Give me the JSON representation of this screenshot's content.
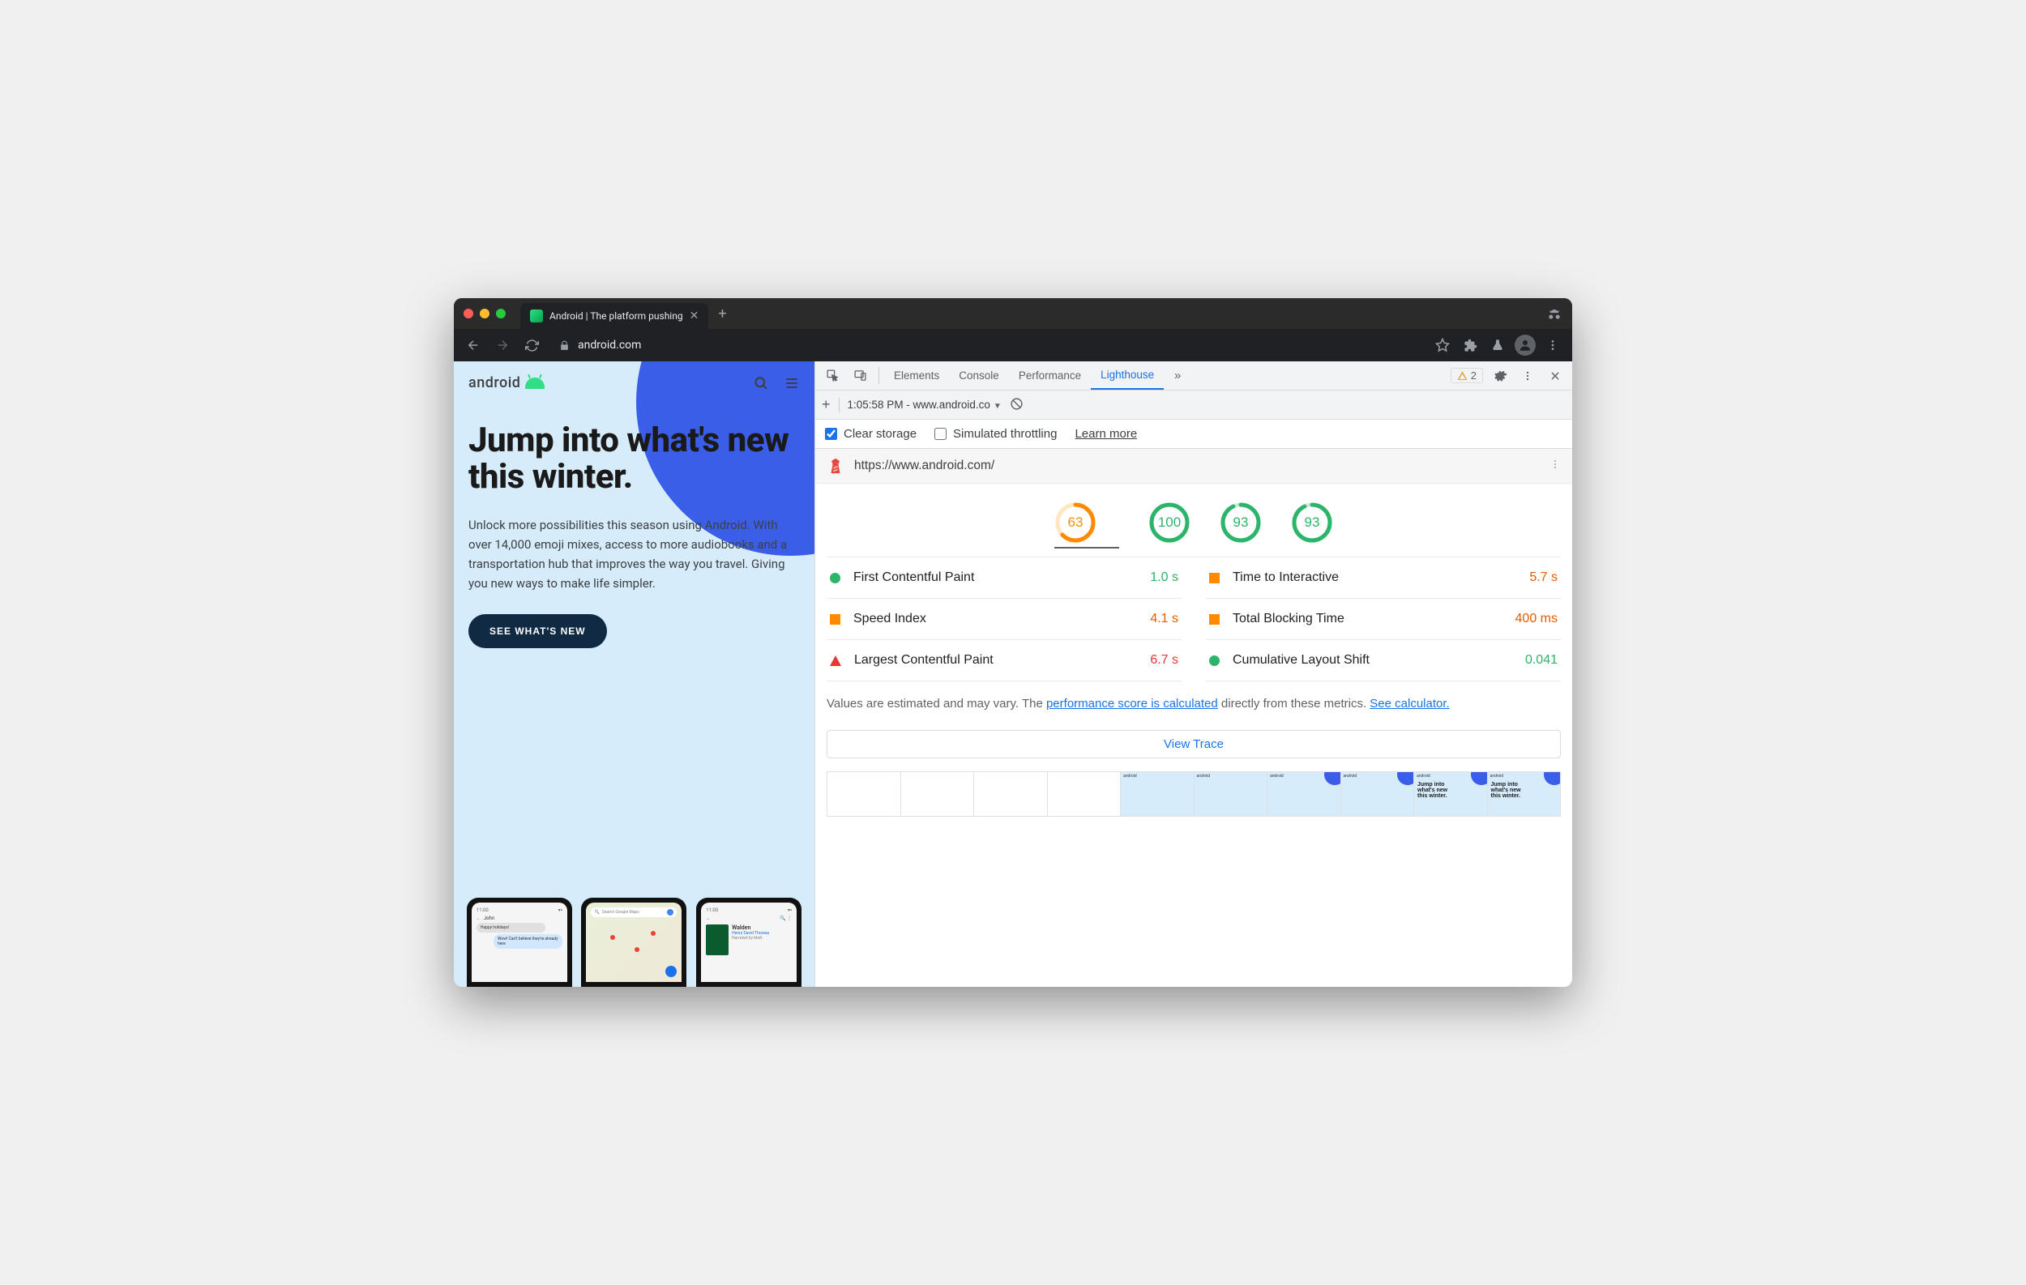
{
  "browser": {
    "tab_title": "Android | The platform pushing",
    "url": "android.com",
    "warnings_count": "2"
  },
  "page": {
    "logo": "android",
    "hero_title": "Jump into what's new this winter.",
    "hero_body": "Unlock more possibilities this season using Android. With over 14,000 emoji mixes, access to more audiobooks and a transportation hub that improves the way you travel. Giving you new ways to make life simpler.",
    "cta": "SEE WHAT'S NEW",
    "phone_mock": {
      "chat_name": "John",
      "chat_msgs": [
        "Happy holidays!",
        "Wow! Can't believe they're already here"
      ],
      "maps_search": "Search Google Maps",
      "book_title": "Walden",
      "book_author": "Henry David Thoreau",
      "book_sub": "Narrated by Matt"
    }
  },
  "devtools": {
    "tabs": {
      "elements": "Elements",
      "console": "Console",
      "performance": "Performance",
      "lighthouse": "Lighthouse"
    },
    "toolbar": {
      "timestamp": "1:05:58 PM - www.android.co"
    },
    "options": {
      "clear_storage": "Clear storage",
      "simulated_throttling": "Simulated throttling",
      "learn_more": "Learn more"
    },
    "report_url": "https://www.android.com/",
    "gauges": [
      {
        "score": "63",
        "color": "#ff8a00",
        "bg": "#ffe7c2",
        "pct": 63
      },
      {
        "score": "100",
        "color": "#2db46b",
        "bg": "#cfead9",
        "pct": 100
      },
      {
        "score": "93",
        "color": "#2db46b",
        "bg": "#cfead9",
        "pct": 93
      },
      {
        "score": "93",
        "color": "#2db46b",
        "bg": "#cfead9",
        "pct": 93
      }
    ],
    "metrics": [
      {
        "shape": "circ",
        "color": "#2db46b",
        "label": "First Contentful Paint",
        "value": "1.0 s",
        "vcolor": "#2db46b"
      },
      {
        "shape": "sq",
        "color": "#ff8a00",
        "label": "Time to Interactive",
        "value": "5.7 s",
        "vcolor": "#e65c00"
      },
      {
        "shape": "sq",
        "color": "#ff8a00",
        "label": "Speed Index",
        "value": "4.1 s",
        "vcolor": "#e65c00"
      },
      {
        "shape": "sq",
        "color": "#ff8a00",
        "label": "Total Blocking Time",
        "value": "400 ms",
        "vcolor": "#e65c00"
      },
      {
        "shape": "tri",
        "color": "#e53935",
        "label": "Largest Contentful Paint",
        "value": "6.7 s",
        "vcolor": "#e53935"
      },
      {
        "shape": "circ",
        "color": "#2db46b",
        "label": "Cumulative Layout Shift",
        "value": "0.041",
        "vcolor": "#2db46b"
      }
    ],
    "footnote_pre": "Values are estimated and may vary. The ",
    "footnote_link1": "performance score is calculated",
    "footnote_mid": " directly from these metrics. ",
    "footnote_link2": "See calculator.",
    "view_trace": "View Trace"
  }
}
